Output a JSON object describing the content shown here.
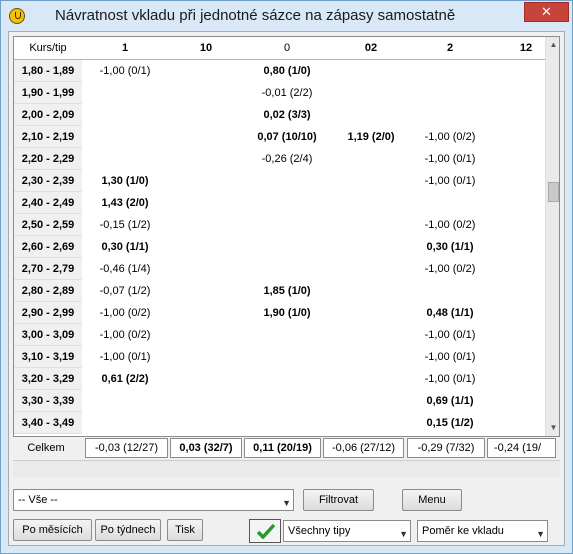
{
  "window": {
    "title": "Návratnost vkladu při jednotné sázce na zápasy samostatně",
    "close_label": "✕"
  },
  "grid": {
    "row_header_label": "Kurs/tip",
    "columns": [
      "1",
      "10",
      "0",
      "02",
      "2",
      "12"
    ],
    "rows": [
      {
        "label": "1,80 - 1,89",
        "cells": [
          "-1,00 (0/1)",
          "",
          "0,80 (1/0)",
          "",
          "",
          ""
        ]
      },
      {
        "label": "1,90 - 1,99",
        "cells": [
          "",
          "",
          "-0,01 (2/2)",
          "",
          "",
          ""
        ]
      },
      {
        "label": "2,00 - 2,09",
        "cells": [
          "",
          "",
          "0,02 (3/3)",
          "",
          "",
          ""
        ]
      },
      {
        "label": "2,10 - 2,19",
        "cells": [
          "",
          "",
          "0,07 (10/10)",
          "1,19 (2/0)",
          "-1,00 (0/2)",
          ""
        ]
      },
      {
        "label": "2,20 - 2,29",
        "cells": [
          "",
          "",
          "-0,26 (2/4)",
          "",
          "-1,00 (0/1)",
          ""
        ]
      },
      {
        "label": "2,30 - 2,39",
        "cells": [
          "1,30 (1/0)",
          "",
          "",
          "",
          "-1,00 (0/1)",
          ""
        ]
      },
      {
        "label": "2,40 - 2,49",
        "cells": [
          "1,43 (2/0)",
          "",
          "",
          "",
          "",
          ""
        ]
      },
      {
        "label": "2,50 - 2,59",
        "cells": [
          "-0,15 (1/2)",
          "",
          "",
          "",
          "-1,00 (0/2)",
          ""
        ]
      },
      {
        "label": "2,60 - 2,69",
        "cells": [
          "0,30 (1/1)",
          "",
          "",
          "",
          "0,30 (1/1)",
          ""
        ]
      },
      {
        "label": "2,70 - 2,79",
        "cells": [
          "-0,46 (1/4)",
          "",
          "",
          "",
          "-1,00 (0/2)",
          ""
        ]
      },
      {
        "label": "2,80 - 2,89",
        "cells": [
          "-0,07 (1/2)",
          "",
          "1,85 (1/0)",
          "",
          "",
          ""
        ]
      },
      {
        "label": "2,90 - 2,99",
        "cells": [
          "-1,00 (0/2)",
          "",
          "1,90 (1/0)",
          "",
          "0,48 (1/1)",
          ""
        ]
      },
      {
        "label": "3,00 - 3,09",
        "cells": [
          "-1,00 (0/2)",
          "",
          "",
          "",
          "-1,00 (0/1)",
          ""
        ]
      },
      {
        "label": "3,10 - 3,19",
        "cells": [
          "-1,00 (0/1)",
          "",
          "",
          "",
          "-1,00 (0/1)",
          ""
        ]
      },
      {
        "label": "3,20 - 3,29",
        "cells": [
          "0,61 (2/2)",
          "",
          "",
          "",
          "-1,00 (0/1)",
          ""
        ]
      },
      {
        "label": "3,30 - 3,39",
        "cells": [
          "",
          "",
          "",
          "",
          "0,69 (1/1)",
          ""
        ]
      },
      {
        "label": "3,40 - 3,49",
        "cells": [
          "",
          "",
          "",
          "",
          "0,15 (1/2)",
          ""
        ]
      }
    ]
  },
  "totals": {
    "label": "Celkem",
    "values": [
      "-0,03 (12/27)",
      "0,03 (32/7)",
      "0,11 (20/19)",
      "-0,06 (27/12)",
      "-0,29 (7/32)",
      "-0,24 (19/"
    ]
  },
  "filter": {
    "selected": "-- Vše --",
    "filter_button": "Filtrovat",
    "menu_button": "Menu"
  },
  "bottom": {
    "by_month": "Po měsících",
    "by_week": "Po týdnech",
    "print": "Tisk",
    "tips_selected": "Všechny tipy",
    "ratio_selected": "Poměr ke vkladu"
  },
  "colors": {
    "accent": "#d8e8f6",
    "close": "#c7443a",
    "check": "#2a9a2a"
  },
  "icons": {
    "app": "ticket-icon",
    "check": "check-icon"
  }
}
